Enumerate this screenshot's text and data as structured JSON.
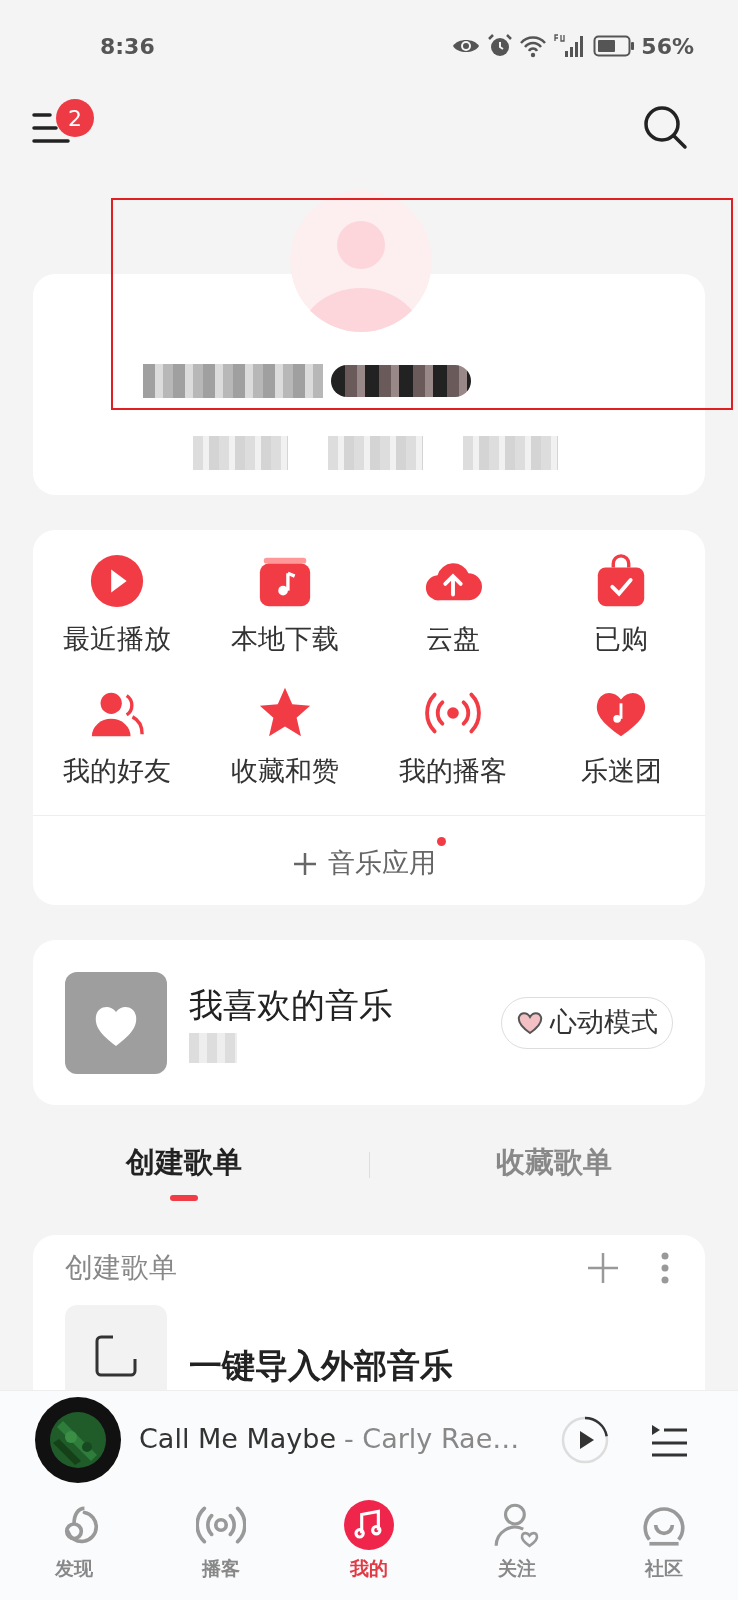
{
  "status_bar": {
    "time": "8:36",
    "battery": "56%"
  },
  "header": {
    "menu_badge": "2"
  },
  "apps": [
    {
      "label": "最近播放"
    },
    {
      "label": "本地下载"
    },
    {
      "label": "云盘"
    },
    {
      "label": "已购"
    },
    {
      "label": "我的好友"
    },
    {
      "label": "收藏和赞"
    },
    {
      "label": "我的播客"
    },
    {
      "label": "乐迷团"
    }
  ],
  "music_apps": {
    "label": "音乐应用",
    "has_dot": true
  },
  "liked": {
    "title": "我喜欢的音乐",
    "button": "心动模式"
  },
  "tabs": [
    {
      "label": "创建歌单",
      "selected": true
    },
    {
      "label": "收藏歌单",
      "selected": false
    }
  ],
  "playlist_section": {
    "title": "创建歌单",
    "item": "一键导入外部音乐"
  },
  "player": {
    "title": "Call Me Maybe",
    "artist": "- Carly Rae…",
    "level": 0.22
  },
  "nav": [
    {
      "label": "发现",
      "selected": false
    },
    {
      "label": "播客",
      "selected": false
    },
    {
      "label": "我的",
      "selected": true
    },
    {
      "label": "关注",
      "selected": false
    },
    {
      "label": "社区",
      "selected": false
    }
  ]
}
